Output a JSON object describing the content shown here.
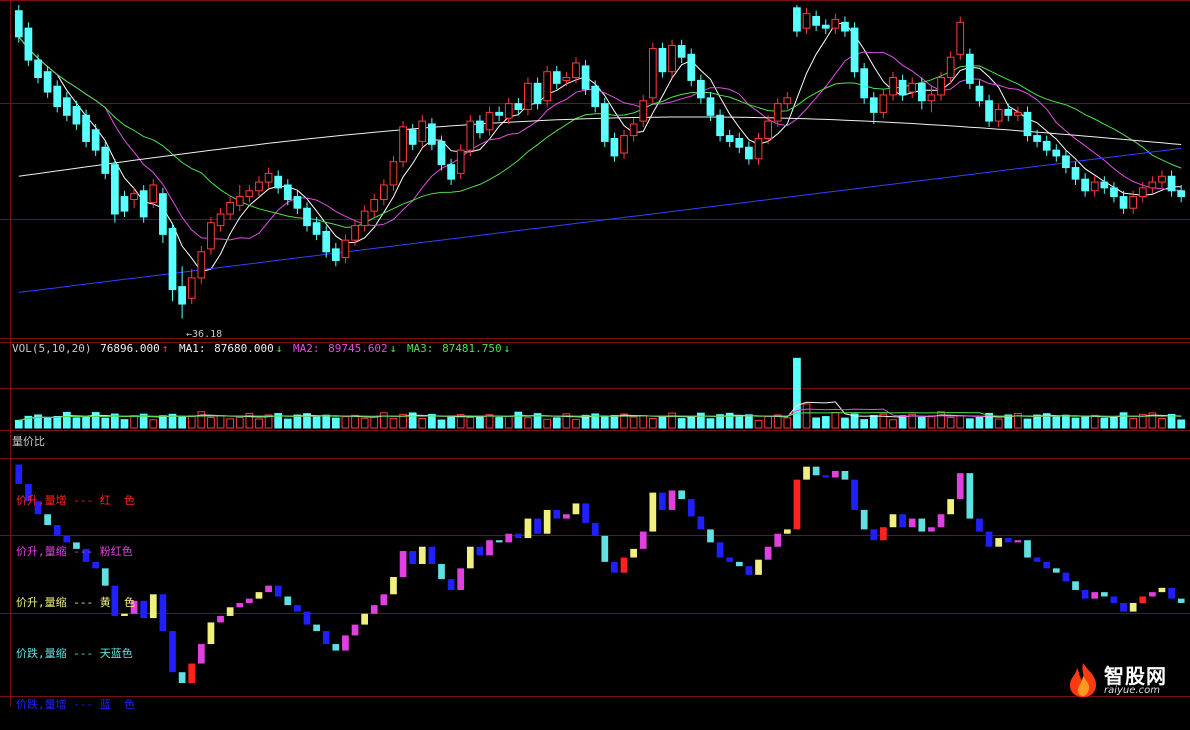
{
  "chart_data": {
    "type": "candlestick",
    "panels": [
      "price",
      "volume",
      "volume-price-ratio"
    ],
    "price": {
      "ylim": [
        35,
        58
      ],
      "low_label": "36.18",
      "ma_colors": [
        "#ffffff",
        "#e050e0",
        "#50e050",
        "#f0f0f0",
        "#3040ff"
      ],
      "bars": [
        [
          57.4,
          55.6,
          57.8,
          55.2
        ],
        [
          56.2,
          54.0,
          56.6,
          53.6
        ],
        [
          54.0,
          52.8,
          54.4,
          52.4
        ],
        [
          53.2,
          51.8,
          53.6,
          51.4
        ],
        [
          52.2,
          50.8,
          52.6,
          50.4
        ],
        [
          51.4,
          50.2,
          51.8,
          49.8
        ],
        [
          50.8,
          49.6,
          51.2,
          49.2
        ],
        [
          50.2,
          48.4,
          50.6,
          48.0
        ],
        [
          49.2,
          47.8,
          49.6,
          47.4
        ],
        [
          48.0,
          46.2,
          48.4,
          45.8
        ],
        [
          46.8,
          43.4,
          47.2,
          42.8
        ],
        [
          44.6,
          43.6,
          45.0,
          43.2
        ],
        [
          44.4,
          44.8,
          45.2,
          43.8
        ],
        [
          45.0,
          43.2,
          45.4,
          42.8
        ],
        [
          44.2,
          45.4,
          45.8,
          43.8
        ],
        [
          44.8,
          42.0,
          45.2,
          41.4
        ],
        [
          42.4,
          38.2,
          42.8,
          37.4
        ],
        [
          38.4,
          37.2,
          39.8,
          36.2
        ],
        [
          37.6,
          39.0,
          39.6,
          37.2
        ],
        [
          39.0,
          40.8,
          41.2,
          38.6
        ],
        [
          41.0,
          42.8,
          43.2,
          40.6
        ],
        [
          42.6,
          43.4,
          43.8,
          42.2
        ],
        [
          43.4,
          44.2,
          44.6,
          43.0
        ],
        [
          44.0,
          44.6,
          45.4,
          43.6
        ],
        [
          44.6,
          45.0,
          45.4,
          44.2
        ],
        [
          45.0,
          45.6,
          46.0,
          44.6
        ],
        [
          45.6,
          46.2,
          46.6,
          45.2
        ],
        [
          46.0,
          45.2,
          46.4,
          44.8
        ],
        [
          45.4,
          44.4,
          45.8,
          44.0
        ],
        [
          44.6,
          43.8,
          45.0,
          43.4
        ],
        [
          43.8,
          42.6,
          44.2,
          42.2
        ],
        [
          42.8,
          42.0,
          43.2,
          41.6
        ],
        [
          42.2,
          40.8,
          42.6,
          40.4
        ],
        [
          41.0,
          40.2,
          41.4,
          39.8
        ],
        [
          40.4,
          41.6,
          42.0,
          40.0
        ],
        [
          41.6,
          42.6,
          43.0,
          41.2
        ],
        [
          42.6,
          43.6,
          44.0,
          42.2
        ],
        [
          43.6,
          44.4,
          44.8,
          43.2
        ],
        [
          44.4,
          45.4,
          45.8,
          44.0
        ],
        [
          45.4,
          47.0,
          47.4,
          45.0
        ],
        [
          47.0,
          49.4,
          49.8,
          46.6
        ],
        [
          49.2,
          48.2,
          49.6,
          47.8
        ],
        [
          48.4,
          49.8,
          50.2,
          48.0
        ],
        [
          49.6,
          48.2,
          50.0,
          47.8
        ],
        [
          48.4,
          46.8,
          48.8,
          46.4
        ],
        [
          46.8,
          45.8,
          47.2,
          45.4
        ],
        [
          46.2,
          47.8,
          48.2,
          45.8
        ],
        [
          47.8,
          49.8,
          50.2,
          47.4
        ],
        [
          49.8,
          49.0,
          50.2,
          48.6
        ],
        [
          49.2,
          50.4,
          50.8,
          48.8
        ],
        [
          50.4,
          50.2,
          50.8,
          49.8
        ],
        [
          50.0,
          51.0,
          51.4,
          49.6
        ],
        [
          51.0,
          50.6,
          51.4,
          50.2
        ],
        [
          50.6,
          52.4,
          52.8,
          50.2
        ],
        [
          52.4,
          51.0,
          52.8,
          50.6
        ],
        [
          51.2,
          53.2,
          53.6,
          50.8
        ],
        [
          53.2,
          52.4,
          53.6,
          52.0
        ],
        [
          52.6,
          52.8,
          53.2,
          52.2
        ],
        [
          52.8,
          53.8,
          54.2,
          52.4
        ],
        [
          53.6,
          52.0,
          54.0,
          51.6
        ],
        [
          52.2,
          50.8,
          52.6,
          50.4
        ],
        [
          51.0,
          48.4,
          51.4,
          48.0
        ],
        [
          48.6,
          47.4,
          49.0,
          47.0
        ],
        [
          47.6,
          48.8,
          49.2,
          47.2
        ],
        [
          48.8,
          49.6,
          50.0,
          48.4
        ],
        [
          49.8,
          51.2,
          51.6,
          49.4
        ],
        [
          51.4,
          54.8,
          55.2,
          51.0
        ],
        [
          54.8,
          53.2,
          55.2,
          52.8
        ],
        [
          53.2,
          55.0,
          55.4,
          52.8
        ],
        [
          55.0,
          54.2,
          55.4,
          53.8
        ],
        [
          54.4,
          52.6,
          54.8,
          52.2
        ],
        [
          52.6,
          51.4,
          53.0,
          51.0
        ],
        [
          51.4,
          50.2,
          51.8,
          49.8
        ],
        [
          50.2,
          48.8,
          50.6,
          48.4
        ],
        [
          48.8,
          48.4,
          49.2,
          48.0
        ],
        [
          48.6,
          48.0,
          49.0,
          47.6
        ],
        [
          48.0,
          47.2,
          48.4,
          46.8
        ],
        [
          47.2,
          48.6,
          49.0,
          46.8
        ],
        [
          48.6,
          49.8,
          50.2,
          48.2
        ],
        [
          49.8,
          51.0,
          51.4,
          49.4
        ],
        [
          51.0,
          51.4,
          51.8,
          50.6
        ],
        [
          57.6,
          56.0,
          57.8,
          55.6
        ],
        [
          56.2,
          57.2,
          57.6,
          55.8
        ],
        [
          57.0,
          56.4,
          57.4,
          56.0
        ],
        [
          56.4,
          56.2,
          56.8,
          55.8
        ],
        [
          56.2,
          56.8,
          57.2,
          55.8
        ],
        [
          56.6,
          56.0,
          57.0,
          55.6
        ],
        [
          56.2,
          53.2,
          56.6,
          52.8
        ],
        [
          53.4,
          51.4,
          53.8,
          51.0
        ],
        [
          51.4,
          50.4,
          51.8,
          49.6
        ],
        [
          50.4,
          51.6,
          52.0,
          50.0
        ],
        [
          51.6,
          52.8,
          53.2,
          51.2
        ],
        [
          52.6,
          51.6,
          53.0,
          51.2
        ],
        [
          51.8,
          52.4,
          52.8,
          51.4
        ],
        [
          52.4,
          51.2,
          52.8,
          50.6
        ],
        [
          51.2,
          51.6,
          52.2,
          50.4
        ],
        [
          51.6,
          52.8,
          53.2,
          51.2
        ],
        [
          52.8,
          54.2,
          54.6,
          52.4
        ],
        [
          54.4,
          56.6,
          57.0,
          54.0
        ],
        [
          54.4,
          52.4,
          54.8,
          52.0
        ],
        [
          52.2,
          51.2,
          52.6,
          50.8
        ],
        [
          51.2,
          49.8,
          51.6,
          49.4
        ],
        [
          49.8,
          50.6,
          51.0,
          49.4
        ],
        [
          50.6,
          50.2,
          51.0,
          49.8
        ],
        [
          50.2,
          50.4,
          50.8,
          49.8
        ],
        [
          50.4,
          48.8,
          50.8,
          48.4
        ],
        [
          48.8,
          48.4,
          49.2,
          48.0
        ],
        [
          48.4,
          47.8,
          48.8,
          47.4
        ],
        [
          47.8,
          47.4,
          48.2,
          47.0
        ],
        [
          47.4,
          46.6,
          47.8,
          46.2
        ],
        [
          46.6,
          45.8,
          47.0,
          45.4
        ],
        [
          45.8,
          45.0,
          46.2,
          44.6
        ],
        [
          45.0,
          45.6,
          46.0,
          44.6
        ],
        [
          45.6,
          45.2,
          46.0,
          44.8
        ],
        [
          45.2,
          44.6,
          45.6,
          44.2
        ],
        [
          44.6,
          43.8,
          45.0,
          43.4
        ],
        [
          43.8,
          44.6,
          45.0,
          43.4
        ],
        [
          44.6,
          45.2,
          45.6,
          44.2
        ],
        [
          45.2,
          45.6,
          46.0,
          44.8
        ],
        [
          45.6,
          46.0,
          46.4,
          45.2
        ],
        [
          46.0,
          45.0,
          46.4,
          44.6
        ],
        [
          45.0,
          44.6,
          45.4,
          44.2
        ]
      ]
    },
    "volume": {
      "indicator": "VOL(5,10,20)",
      "readouts": [
        {
          "label": "",
          "value": "76896.000",
          "arrow": "↑",
          "color": "#f0f0f0"
        },
        {
          "label": "MA1:",
          "value": "87680.000",
          "arrow": "↓",
          "color": "#f0f0f0"
        },
        {
          "label": "MA2:",
          "value": "89745.602",
          "arrow": "↓",
          "color": "#e050e0"
        },
        {
          "label": "MA3:",
          "value": "87481.750",
          "arrow": "↓",
          "color": "#50e050"
        }
      ],
      "ylim": [
        0,
        600000
      ],
      "spike_value": 550000
    },
    "vpr": {
      "title": "量价比",
      "legend": [
        {
          "label": "价升,量增",
          "dash": "---",
          "name": "红  色",
          "color": "#ff2020"
        },
        {
          "label": "价升,量缩",
          "dash": "---",
          "name": "粉红色",
          "color": "#e040e0"
        },
        {
          "label": "价升,量缩",
          "dash": "---",
          "name": "黄  色",
          "color": "#f0f080"
        },
        {
          "label": "价跌,量缩",
          "dash": "---",
          "name": "天蓝色",
          "color": "#60e0e0"
        },
        {
          "label": "价跌,量增",
          "dash": "---",
          "name": "蓝  色",
          "color": "#2020ff"
        }
      ],
      "colors": {
        "red": "#ff2020",
        "pink": "#e040e0",
        "yellow": "#f0f080",
        "cyan": "#60e0e0",
        "blue": "#2020ff"
      }
    }
  },
  "watermark": {
    "title": "智股网",
    "url": "raiyue.com"
  },
  "colors": {
    "up": "#ff3a3a",
    "down": "#5affff",
    "grid": "#7a1010",
    "bg": "#000000"
  }
}
